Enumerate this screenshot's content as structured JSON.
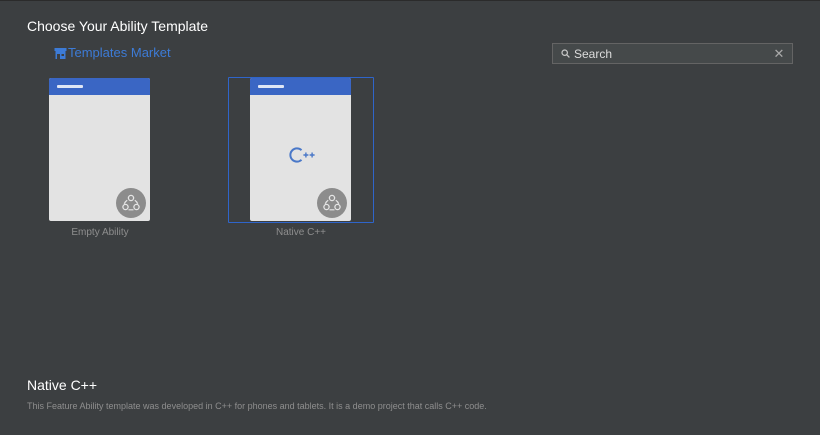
{
  "header": {
    "title": "Choose Your Ability Template"
  },
  "market": {
    "label": "Templates Market",
    "icon": "store-icon"
  },
  "search": {
    "placeholder": "Search",
    "value": "",
    "icon": "search-icon",
    "clear_label": "✕"
  },
  "templates": [
    {
      "label": "Empty Ability",
      "selected": false,
      "icon": "ability-icon"
    },
    {
      "label": "Native C++",
      "selected": true,
      "icon": "ability-icon",
      "logo": "cpp-logo-icon"
    }
  ],
  "selected_template": {
    "title": "Native C++",
    "description": "This Feature Ability template was developed in C++ for phones and tablets. It is a demo project that calls C++ code."
  },
  "colors": {
    "background": "#3c3f41",
    "accent": "#2f65ca",
    "thumbnail_header": "#3a66c4",
    "link": "#3d7bd6"
  }
}
